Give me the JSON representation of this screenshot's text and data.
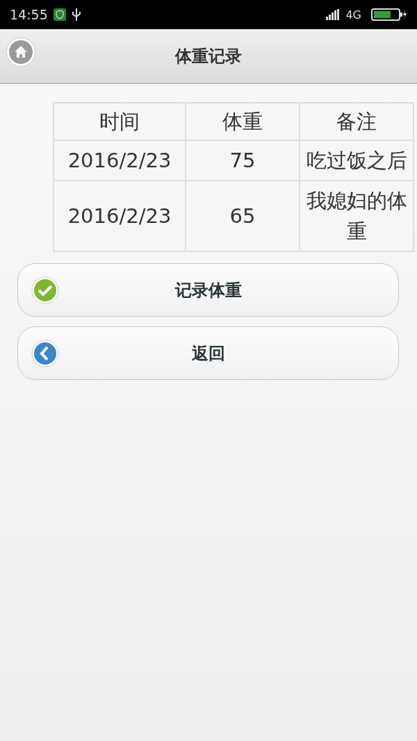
{
  "status_bar": {
    "time": "14:55",
    "network": "4G"
  },
  "header": {
    "title": "体重记录"
  },
  "table": {
    "columns": [
      "时间",
      "体重",
      "备注"
    ],
    "rows": [
      [
        "2016/2/23",
        "75",
        "吃过饭之后"
      ],
      [
        "2016/2/23",
        "65",
        "我媳妇的体重"
      ]
    ]
  },
  "buttons": [
    {
      "label": "记录体重",
      "kind": "confirm"
    },
    {
      "label": "返回",
      "kind": "back"
    }
  ]
}
